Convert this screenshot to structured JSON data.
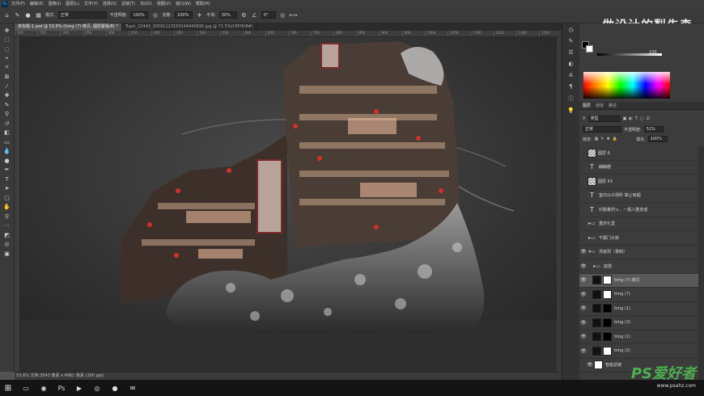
{
  "menu": {
    "items": [
      "文件(F)",
      "编辑(E)",
      "图像(I)",
      "图层(L)",
      "文字(Y)",
      "选择(S)",
      "滤镜(T)",
      "3D(D)",
      "视图(V)",
      "窗口(W)",
      "帮助(H)"
    ]
  },
  "options": {
    "mode_label": "模式:",
    "mode_value": "正常",
    "opacity_label": "不透明度:",
    "opacity_value": "100%",
    "flow_label": "流量:",
    "flow_value": "100%",
    "smooth_label": "平滑:",
    "smooth_value": "30%",
    "angle_value": "0°"
  },
  "watermark": "做设计的梨先森",
  "tabs": [
    {
      "label": "未标题-1.psd @ 53.6% (timg (7) 拷贝, 图层蒙版/8) *"
    },
    {
      "label": "Tupic_22443_20091123150144440695.jpg @ 71.5%(CMYK/8#)"
    }
  ],
  "ruler": [
    "100",
    "150",
    "200",
    "250",
    "300",
    "350",
    "400",
    "450",
    "500",
    "550",
    "600",
    "650",
    "700",
    "750",
    "800",
    "850",
    "900",
    "950",
    "1000",
    "1050",
    "1100",
    "1150",
    "1200",
    "1250"
  ],
  "status": "53.6%   文档:3543 像素 x 4961 像素 (300 ppi)",
  "color": {
    "slider_value": "100"
  },
  "layers_panel": {
    "tabs": [
      "图层",
      "通道",
      "路径"
    ],
    "filter_label": "类型",
    "blend": "正常",
    "opacity_label": "不透明度:",
    "opacity_value": "51%",
    "fill_label": "填充:",
    "fill_value": "100%",
    "lock_label": "锁定:",
    "items": [
      {
        "name": "图层 6",
        "kind": "raster",
        "visible": false
      },
      {
        "name": "翩翩越",
        "kind": "text",
        "visible": false
      },
      {
        "name": "图层 43",
        "kind": "raster",
        "visible": false
      },
      {
        "name": "室内公众场所 禁止吸烟",
        "kind": "text",
        "visible": false
      },
      {
        "name": "印勤着的's... 一般人剧变成",
        "kind": "text",
        "visible": false
      },
      {
        "name": "重庆礼堂",
        "kind": "group",
        "visible": false
      },
      {
        "name": "千厮门大桥",
        "kind": "group",
        "visible": false
      },
      {
        "name": "洪崖洞（录制）",
        "kind": "group",
        "visible": true
      },
      {
        "name": "底部",
        "kind": "group",
        "visible": true
      },
      {
        "name": "timg (7) 拷贝",
        "kind": "mask",
        "visible": true,
        "selected": true
      },
      {
        "name": "timg (7)",
        "kind": "mask",
        "visible": true
      },
      {
        "name": "timg (1)",
        "kind": "mask",
        "visible": true
      },
      {
        "name": "timg (3)",
        "kind": "mask",
        "visible": true
      },
      {
        "name": "timg (1)",
        "kind": "mask2",
        "visible": true
      },
      {
        "name": "timg (2)",
        "kind": "mask2",
        "visible": true
      },
      {
        "name": "智能滤镜",
        "kind": "filter",
        "visible": true
      }
    ]
  },
  "site_logo": "PS爱好者",
  "site_url": "www.psahz.com"
}
